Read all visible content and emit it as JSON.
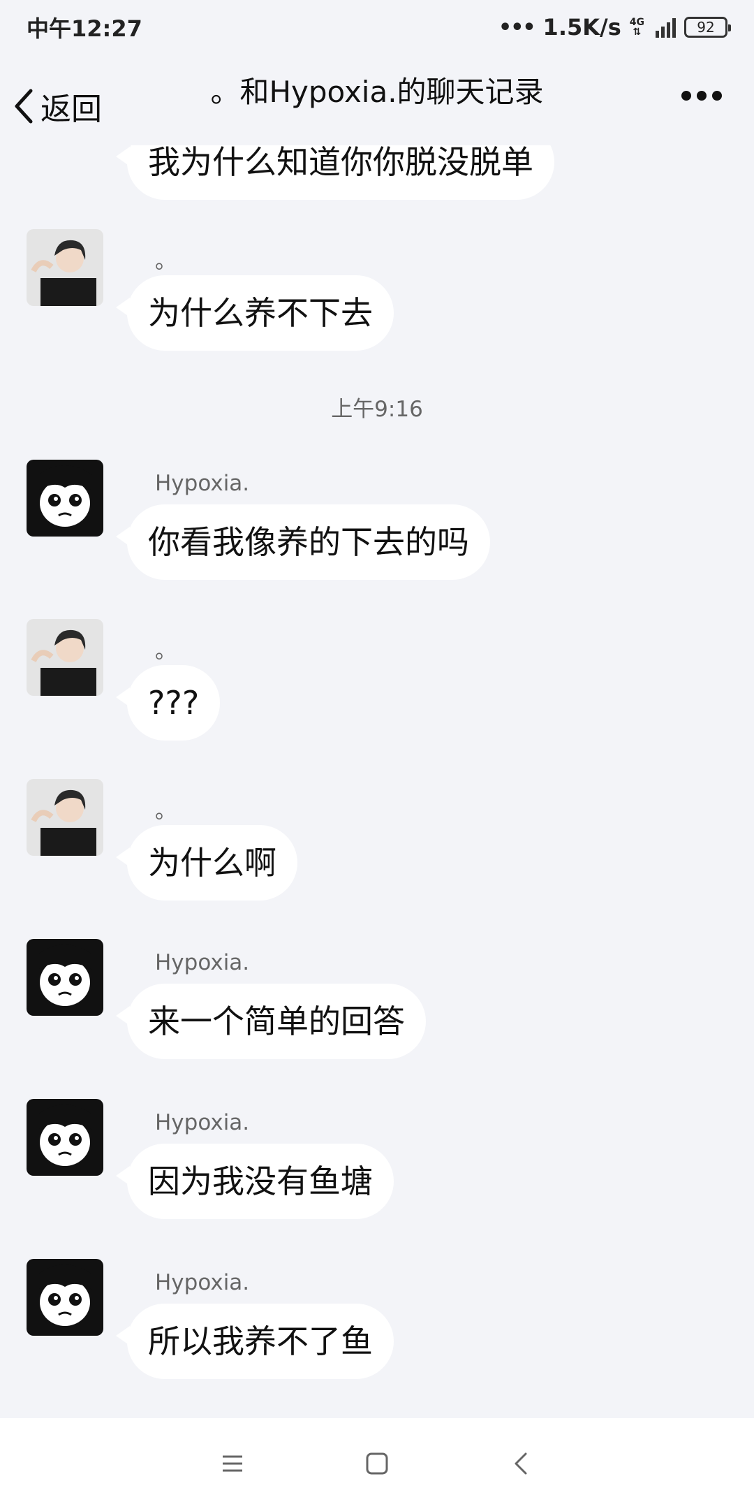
{
  "status_bar": {
    "time": "中午12:27",
    "dots": "•••",
    "speed": "1.5K/s",
    "network": "4G",
    "battery": "92"
  },
  "header": {
    "back_label": "返回",
    "title": "。和Hypoxia.的聊天记录",
    "more_icon": "more-dots-icon"
  },
  "chat": {
    "partial_message": "我为什么知道你你脱没脱单",
    "timestamp": "上午9:16",
    "messages": [
      {
        "sender": "。",
        "text": "为什么养不下去"
      },
      {
        "sender": "Hypoxia.",
        "text": "你看我像养的下去的吗"
      },
      {
        "sender": "。",
        "text": "???"
      },
      {
        "sender": "。",
        "text": "为什么啊"
      },
      {
        "sender": "Hypoxia.",
        "text": "来一个简单的回答"
      },
      {
        "sender": "Hypoxia.",
        "text": "因为我没有鱼塘"
      },
      {
        "sender": "Hypoxia.",
        "text": "所以我养不了鱼"
      }
    ]
  },
  "nav_bar": {
    "icons": [
      "menu-icon",
      "home-icon",
      "back-icon"
    ]
  }
}
